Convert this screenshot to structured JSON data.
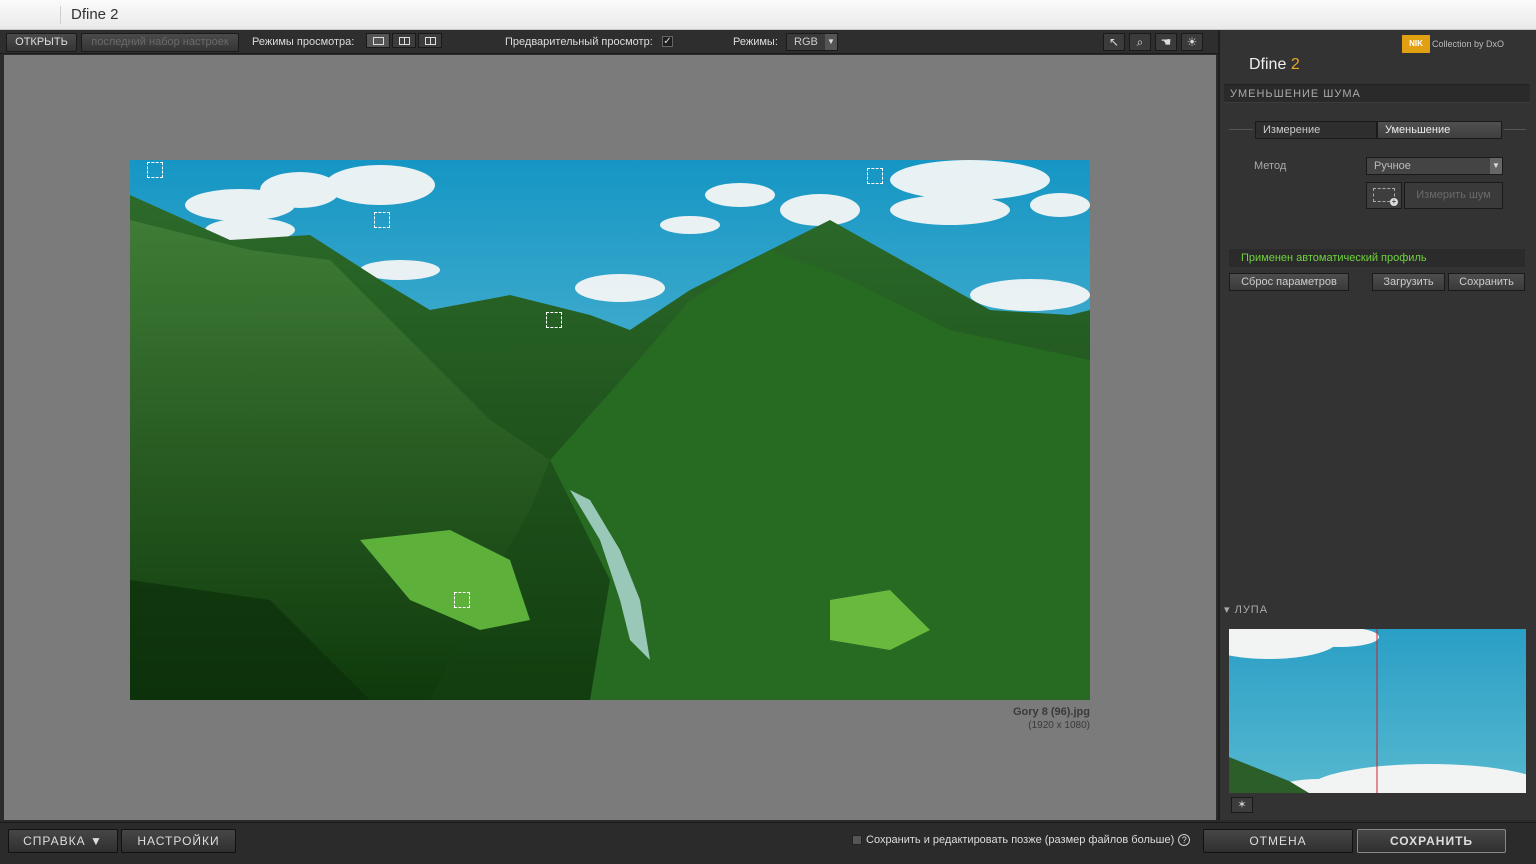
{
  "window": {
    "title": "Dfine 2"
  },
  "toolbar": {
    "open_label": "ОТКРЫТЬ",
    "last_preset_label": "последний набор настроек",
    "view_modes_label": "Режимы просмотра:",
    "preview_label": "Предварительный просмотр:",
    "preview_checked": true,
    "modes_label": "Режимы:",
    "mode_value": "RGB",
    "tools": [
      {
        "icon": "pointer-icon",
        "glyph": "↖"
      },
      {
        "icon": "zoom-icon",
        "glyph": "🔍"
      },
      {
        "icon": "hand-icon",
        "glyph": "✋"
      },
      {
        "icon": "light-icon",
        "glyph": "☀"
      }
    ]
  },
  "image": {
    "filename": "Gory 8 (96).jpg",
    "dimensions": "(1920 x 1080)"
  },
  "sidebar": {
    "brand_logo": "NIK",
    "brand_caption": "Collection by DxO",
    "product_name": "Dfine",
    "product_version": "2",
    "section_title": "УМЕНЬШЕНИЕ ШУМА",
    "tabs": [
      "Измерение",
      "Уменьшение"
    ],
    "active_tab": "Уменьшение",
    "method_label": "Метод",
    "method_value": "Ручное",
    "measure_button": "Измерить шум",
    "profile_message": "Применен автоматический профиль",
    "reset_button": "Сброс параметров",
    "load_button": "Загрузить",
    "save_button": "Сохранить",
    "loupe_title": "ЛУПА",
    "colors": {
      "accent": "#e9a825",
      "status_green": "#6fd33b"
    }
  },
  "bottom": {
    "help_label": "СПРАВКА ▼",
    "settings_label": "НАСТРОЙКИ",
    "save_later_label": "Сохранить и редактировать позже (размер файлов больше)",
    "help_icon": "?",
    "cancel_label": "ОТМЕНА",
    "save_label": "СОХРАНИТЬ"
  }
}
